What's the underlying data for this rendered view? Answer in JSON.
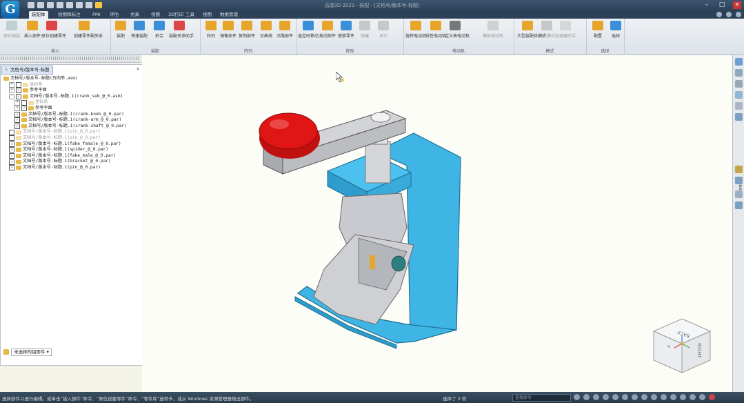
{
  "app": {
    "logo_letter": "G",
    "window_title": "迅捷3D 2021 - 装配 - [文档号/版本号-标题]"
  },
  "tabs": [
    {
      "label": "装配体",
      "active": true
    },
    {
      "label": "插图和标注",
      "active": false
    },
    {
      "label": "PMI",
      "active": false
    },
    {
      "label": "评估",
      "active": false
    },
    {
      "label": "仿真",
      "active": false
    },
    {
      "label": "视图",
      "active": false
    },
    {
      "label": "3D打印",
      "active": false
    },
    {
      "label": "工具",
      "active": false
    },
    {
      "label": "视图",
      "active": false
    },
    {
      "label": "数据管理",
      "active": false
    }
  ],
  "ribbon": {
    "groups": [
      "插入",
      "装配",
      "阵列",
      "修改",
      "电动机",
      "模式",
      "选择"
    ],
    "buttons": [
      {
        "label": "原位插装",
        "dim": true
      },
      {
        "label": "插入部件",
        "dim": false
      },
      {
        "label": "原位创建零件",
        "dim": false
      },
      {
        "label": "创建零件副关系",
        "dim": false
      },
      {
        "label": "装配",
        "dim": false
      },
      {
        "label": "快速装配",
        "dim": false
      },
      {
        "label": "拍合",
        "dim": false
      },
      {
        "label": "装配关系助手",
        "dim": false
      },
      {
        "label": "阵列",
        "dim": false
      },
      {
        "label": "镜像部件",
        "dim": false
      },
      {
        "label": "复制部件",
        "dim": false
      },
      {
        "label": "沿曲线",
        "dim": false
      },
      {
        "label": "沿路部件",
        "dim": false
      },
      {
        "label": "选定时移动",
        "dim": false
      },
      {
        "label": "拖动部件",
        "dim": false
      },
      {
        "label": "替换零件",
        "dim": false
      },
      {
        "label": "隐藏",
        "dim": true
      },
      {
        "label": "显示",
        "dim": true
      },
      {
        "label": "旋转电动机",
        "dim": false
      },
      {
        "label": "线性电动机",
        "dim": false
      },
      {
        "label": "定义表电动机",
        "dim": false
      },
      {
        "label": "模拟电动机",
        "dim": true
      },
      {
        "label": "大型装配体模式",
        "dim": false
      },
      {
        "label": "简化模式",
        "dim": true
      },
      {
        "label": "处理器助手",
        "dim": true
      },
      {
        "label": "配置",
        "dim": false
      },
      {
        "label": "选择",
        "dim": false
      }
    ]
  },
  "pane": {
    "tab_label": "文档号/版本号-标题"
  },
  "tree": [
    {
      "label": "文档号/版本号-标题(万向节.asm)",
      "indent": 0,
      "exp": "",
      "cb": "",
      "dim": false
    },
    {
      "label": "坐标系",
      "indent": 1,
      "exp": "+",
      "cb": "",
      "dim": true
    },
    {
      "label": "参考平面",
      "indent": 1,
      "exp": "+",
      "cb": "✓",
      "dim": false
    },
    {
      "label": "文档号/版本号-标题.1(crank_sub_@_0.asm)",
      "indent": 1,
      "exp": "-",
      "cb": "✓",
      "dim": false
    },
    {
      "label": "坐标系",
      "indent": 2,
      "exp": "+",
      "cb": "",
      "dim": true
    },
    {
      "label": "参考平面",
      "indent": 2,
      "exp": "+",
      "cb": "✓",
      "dim": false
    },
    {
      "label": "文档号/版本号-标题.1(crank-knob_@_0.par)",
      "indent": 2,
      "exp": "",
      "cb": "✓",
      "dim": false
    },
    {
      "label": "文档号/版本号-标题.1(crank-arm_@_0.par)",
      "indent": 2,
      "exp": "",
      "cb": "✓",
      "dim": false
    },
    {
      "label": "文档号/版本号-标题.1(crank-shaft_@_0.par)",
      "indent": 2,
      "exp": "",
      "cb": "✓",
      "dim": false
    },
    {
      "label": "文档号/版本号-标题.1(pin_@_0.par)",
      "indent": 1,
      "exp": "",
      "cb": "",
      "dim": true
    },
    {
      "label": "文档号/版本号-标题.1(pin_@_0.par)",
      "indent": 1,
      "exp": "",
      "cb": "",
      "dim": true
    },
    {
      "label": "文档号/版本号-标题.1(fake_female_@_0.par)",
      "indent": 1,
      "exp": "",
      "cb": "✓",
      "dim": false
    },
    {
      "label": "文档号/版本号-标题.1(spider_@_0.par)",
      "indent": 1,
      "exp": "",
      "cb": "✓",
      "dim": false
    },
    {
      "label": "文档号/版本号-标题.1(fake_male_@_0.par)",
      "indent": 1,
      "exp": "",
      "cb": "✓",
      "dim": false
    },
    {
      "label": "文档号/版本号-标题.1(bracket_@_0.par)",
      "indent": 1,
      "exp": "",
      "cb": "✓",
      "dim": false
    },
    {
      "label": "文档号/版本号-标题.1(pin_@_0.par)",
      "indent": 1,
      "exp": "",
      "cb": "✓",
      "dim": false
    }
  ],
  "pane_bottom": {
    "selector_label": "未选择的组零件"
  },
  "navcube": {
    "face_top": "BACK",
    "face_right": "RIGHT"
  },
  "rightbar_text": "零件库",
  "status": {
    "prompt": "选择部件以进行编辑。或单击“插入部件”命令、“原位创建零件”命令、“零件库”选项卡，或从 Windows 资源管理器拖出部件。",
    "selection": "选择了 0 项",
    "command_placeholder": "查找命令"
  },
  "colors": {
    "bracket": "#3fb5e6",
    "knob": "#e01515",
    "metal": "#c9cacf",
    "titlebar": "#2c4157"
  }
}
